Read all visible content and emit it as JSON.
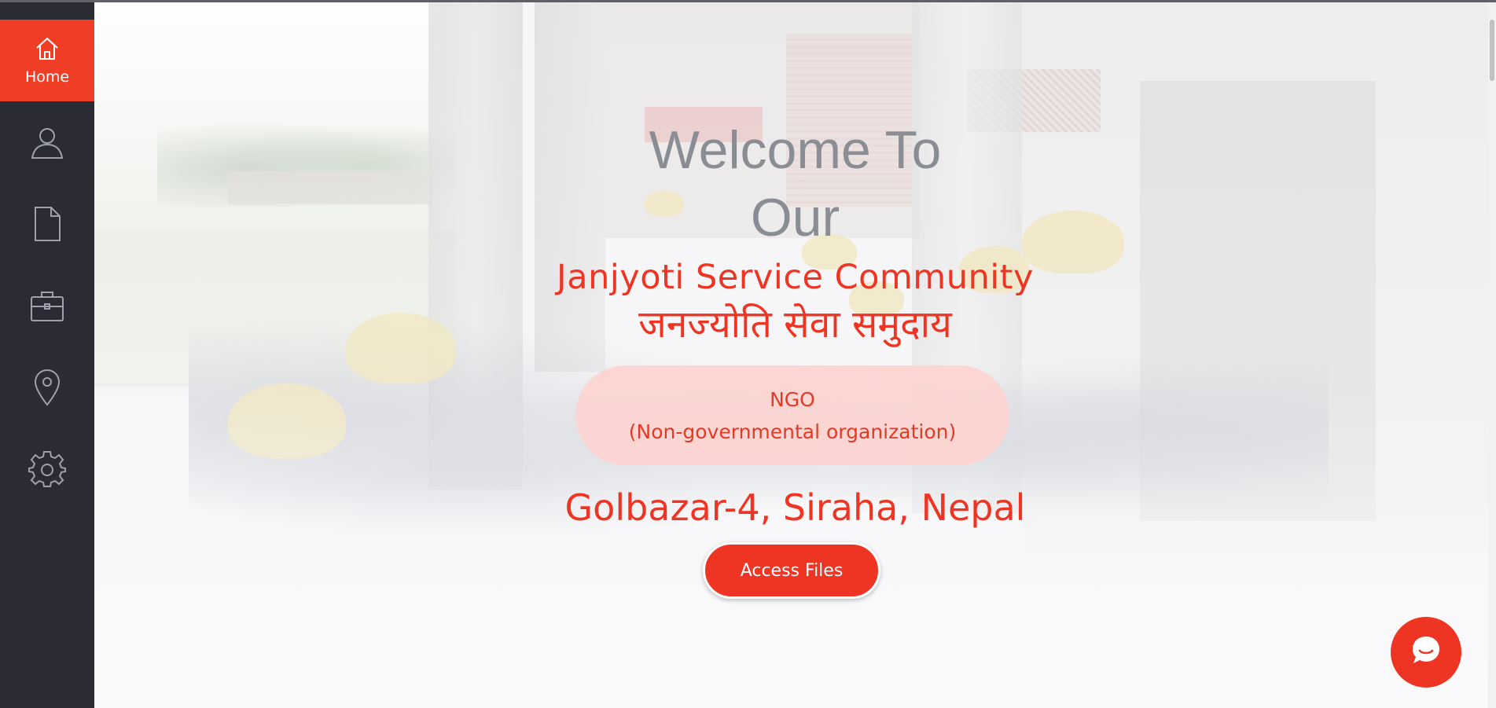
{
  "sidebar": {
    "items": [
      {
        "label": "Home",
        "icon": "home-icon",
        "active": true
      },
      {
        "label": "",
        "icon": "user-icon",
        "active": false
      },
      {
        "label": "",
        "icon": "document-icon",
        "active": false
      },
      {
        "label": "",
        "icon": "briefcase-icon",
        "active": false
      },
      {
        "label": "",
        "icon": "location-pin-icon",
        "active": false
      },
      {
        "label": "",
        "icon": "gear-icon",
        "active": false
      }
    ]
  },
  "hero": {
    "welcome_line1": "Welcome To",
    "welcome_line2": "Our",
    "org_name_en": "Janjyoti Service Community",
    "org_name_np": "जनज्योति सेवा समुदाय",
    "badge_line1": "NGO",
    "badge_line2": "(Non-governmental organization)",
    "address": "Golbazar-4, Siraha, Nepal",
    "cta_label": "Access Files"
  },
  "colors": {
    "accent": "#ee3524",
    "sidebar_bg": "#2a2b33",
    "badge_bg": "#fcd4d0",
    "welcome_text": "#8a8d93"
  },
  "chat": {
    "icon": "chat-bubble-icon"
  }
}
